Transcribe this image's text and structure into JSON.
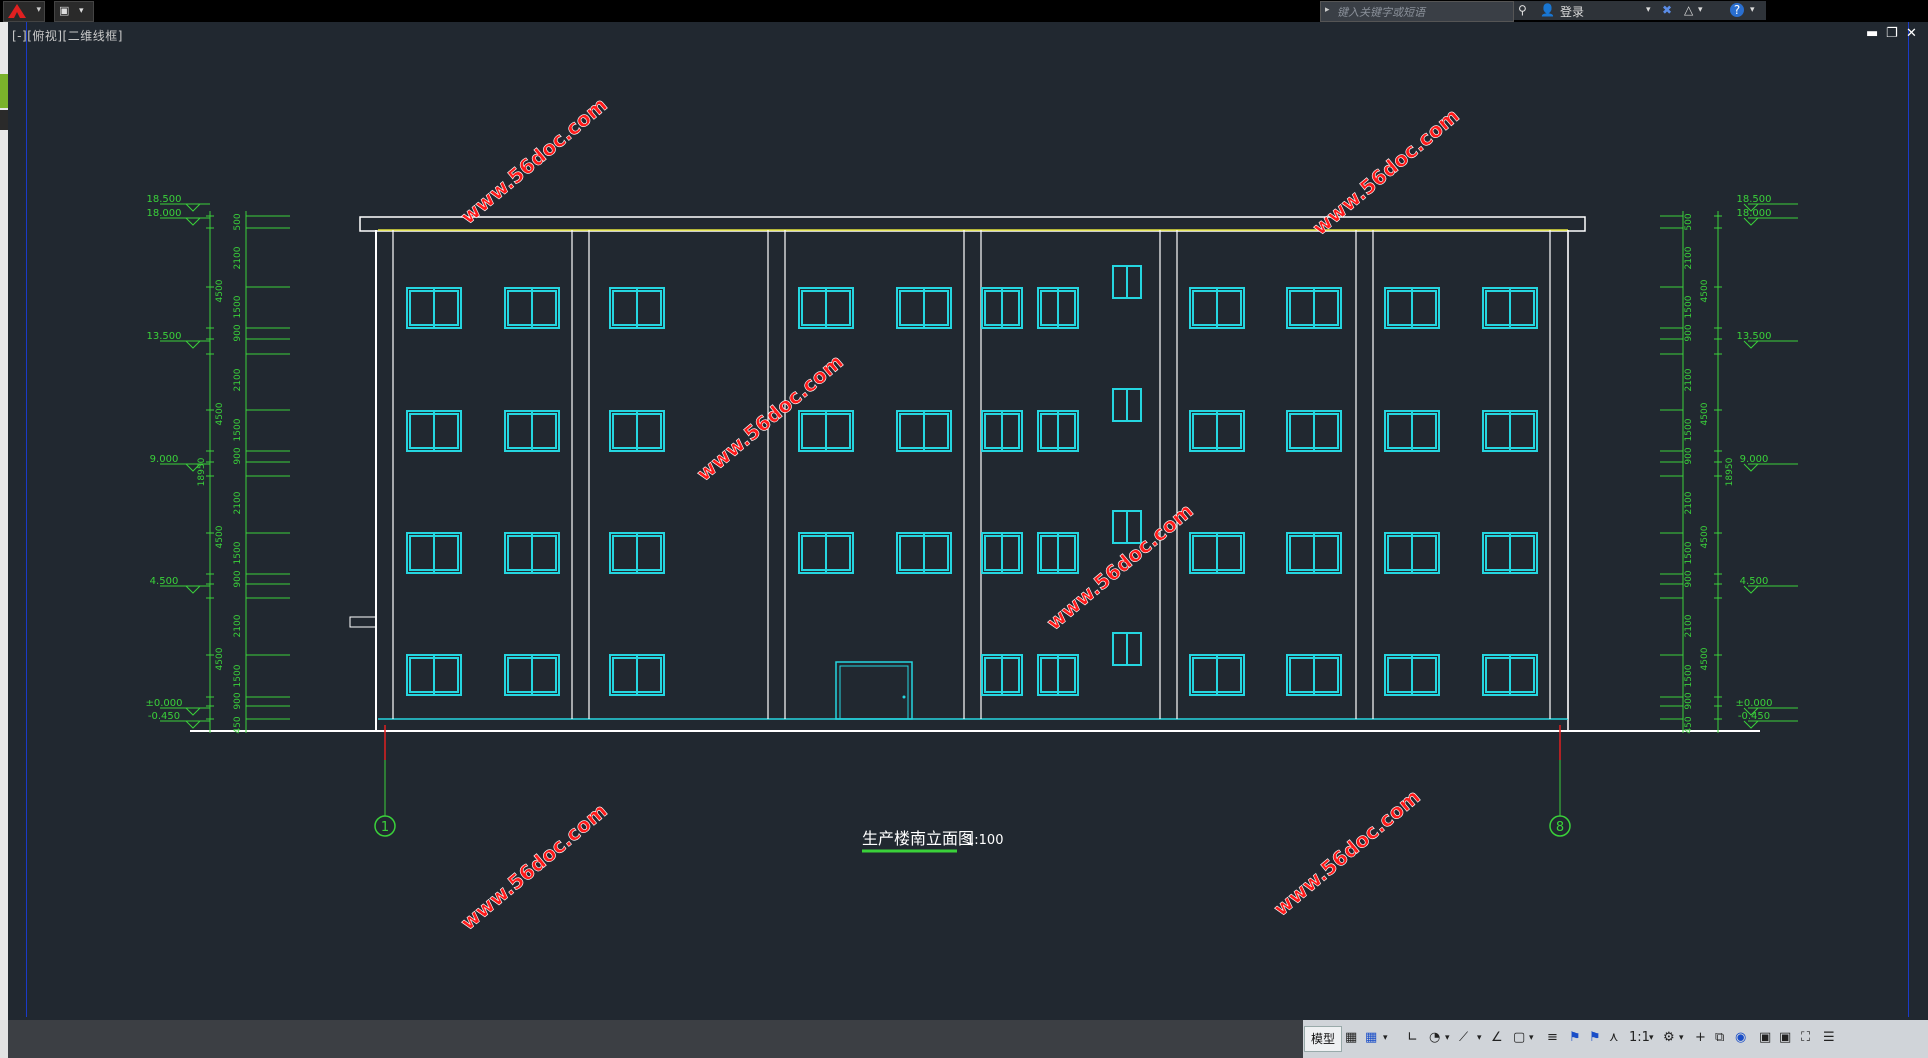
{
  "titlebar": {
    "search_placeholder": "键入关键字或短语",
    "login_label": "登录",
    "help_icon": "help-icon"
  },
  "viewport": {
    "label": "[-][俯视][二维线框]"
  },
  "drawing": {
    "title": "生产楼南立面图",
    "scale": "1:100",
    "axis_left": "1",
    "axis_right": "8",
    "watermark": "www.56doc.com",
    "elevations": [
      "18.500",
      "18.000",
      "13.500",
      "9.000",
      "4.500",
      "±0.000",
      "-0.450"
    ],
    "dims_story": [
      "500",
      "2100",
      "1500",
      "900",
      "4500"
    ],
    "dim_total": "18950",
    "dim_base": "450"
  },
  "statusbar": {
    "model_tab": "模型",
    "scale": "1:1"
  },
  "colors": {
    "background": "#212830",
    "window": "#25d6e0",
    "dimension": "#3ad13a",
    "wall": "#ffffff",
    "watermark": "#ff1a1a",
    "roof_line": "#e2e23a"
  }
}
